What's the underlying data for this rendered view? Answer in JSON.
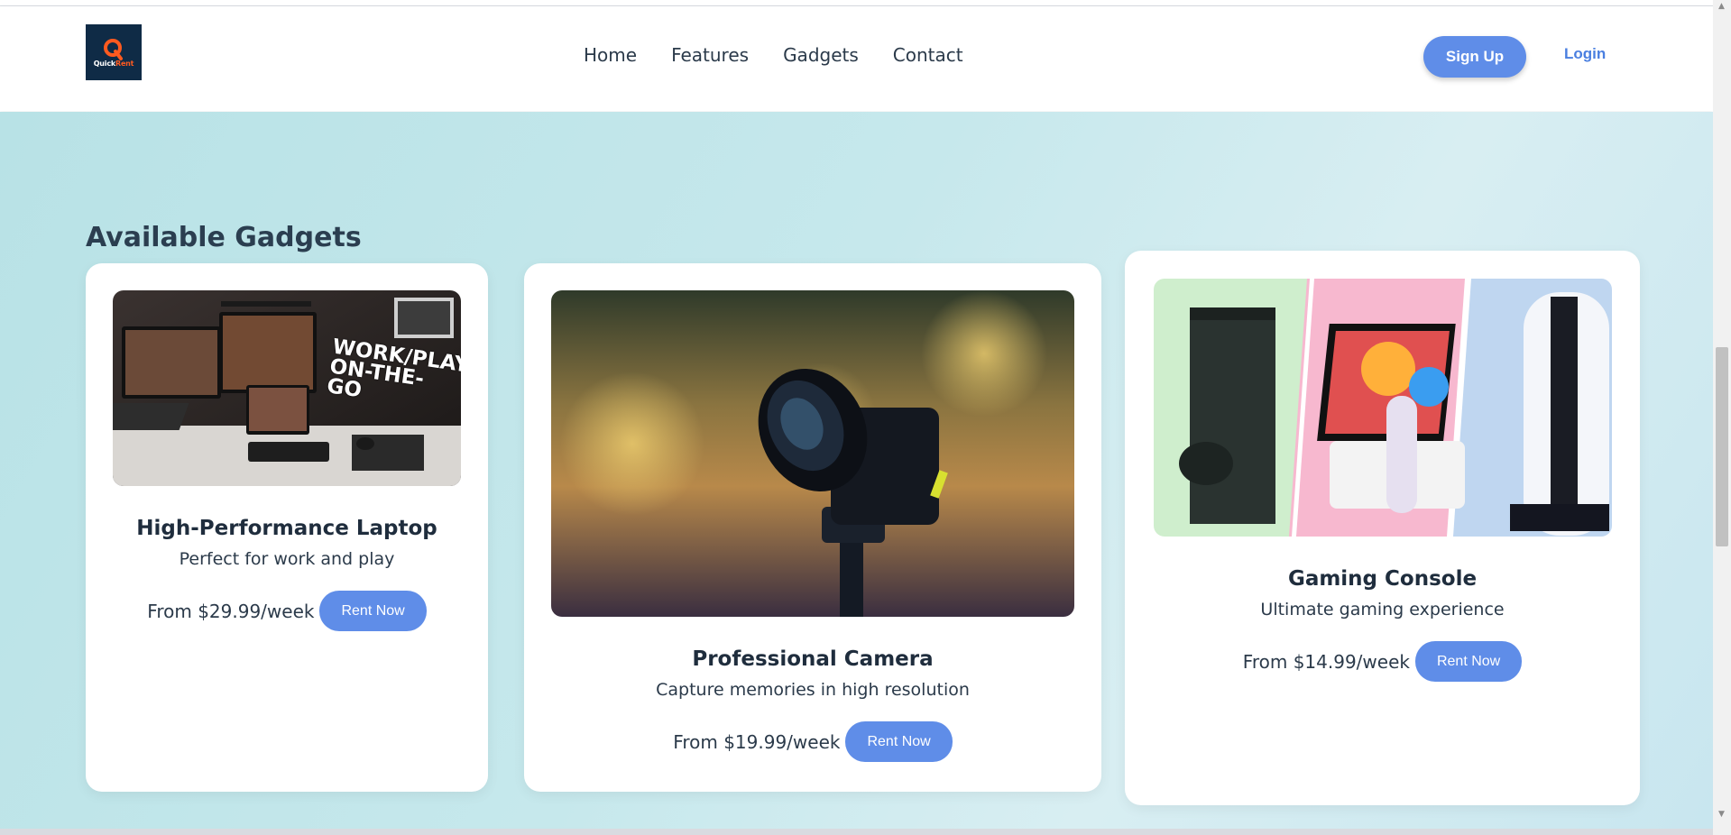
{
  "brand": {
    "logo_text_1": "Quick",
    "logo_text_2": "Rent"
  },
  "nav": {
    "links": [
      "Home",
      "Features",
      "Gadgets",
      "Contact"
    ],
    "signup": "Sign Up",
    "login": "Login"
  },
  "section": {
    "title": "Available Gadgets"
  },
  "cards": [
    {
      "title": "High-Performance Laptop",
      "description": "Perfect for work and play",
      "price": "From $29.99/week",
      "button": "Rent Now",
      "image_overlay_text": "WORK/PLAY ON-THE-GO"
    },
    {
      "title": "Professional Camera",
      "description": "Capture memories in high resolution",
      "price": "From $19.99/week",
      "button": "Rent Now"
    },
    {
      "title": "Gaming Console",
      "description": "Ultimate gaming experience",
      "price": "From $14.99/week",
      "button": "Rent Now"
    }
  ],
  "colors": {
    "accent": "#5f8de8",
    "brand_dark": "#0f2b46",
    "brand_orange": "#ff5a1f",
    "background": "#c6e8ec"
  }
}
